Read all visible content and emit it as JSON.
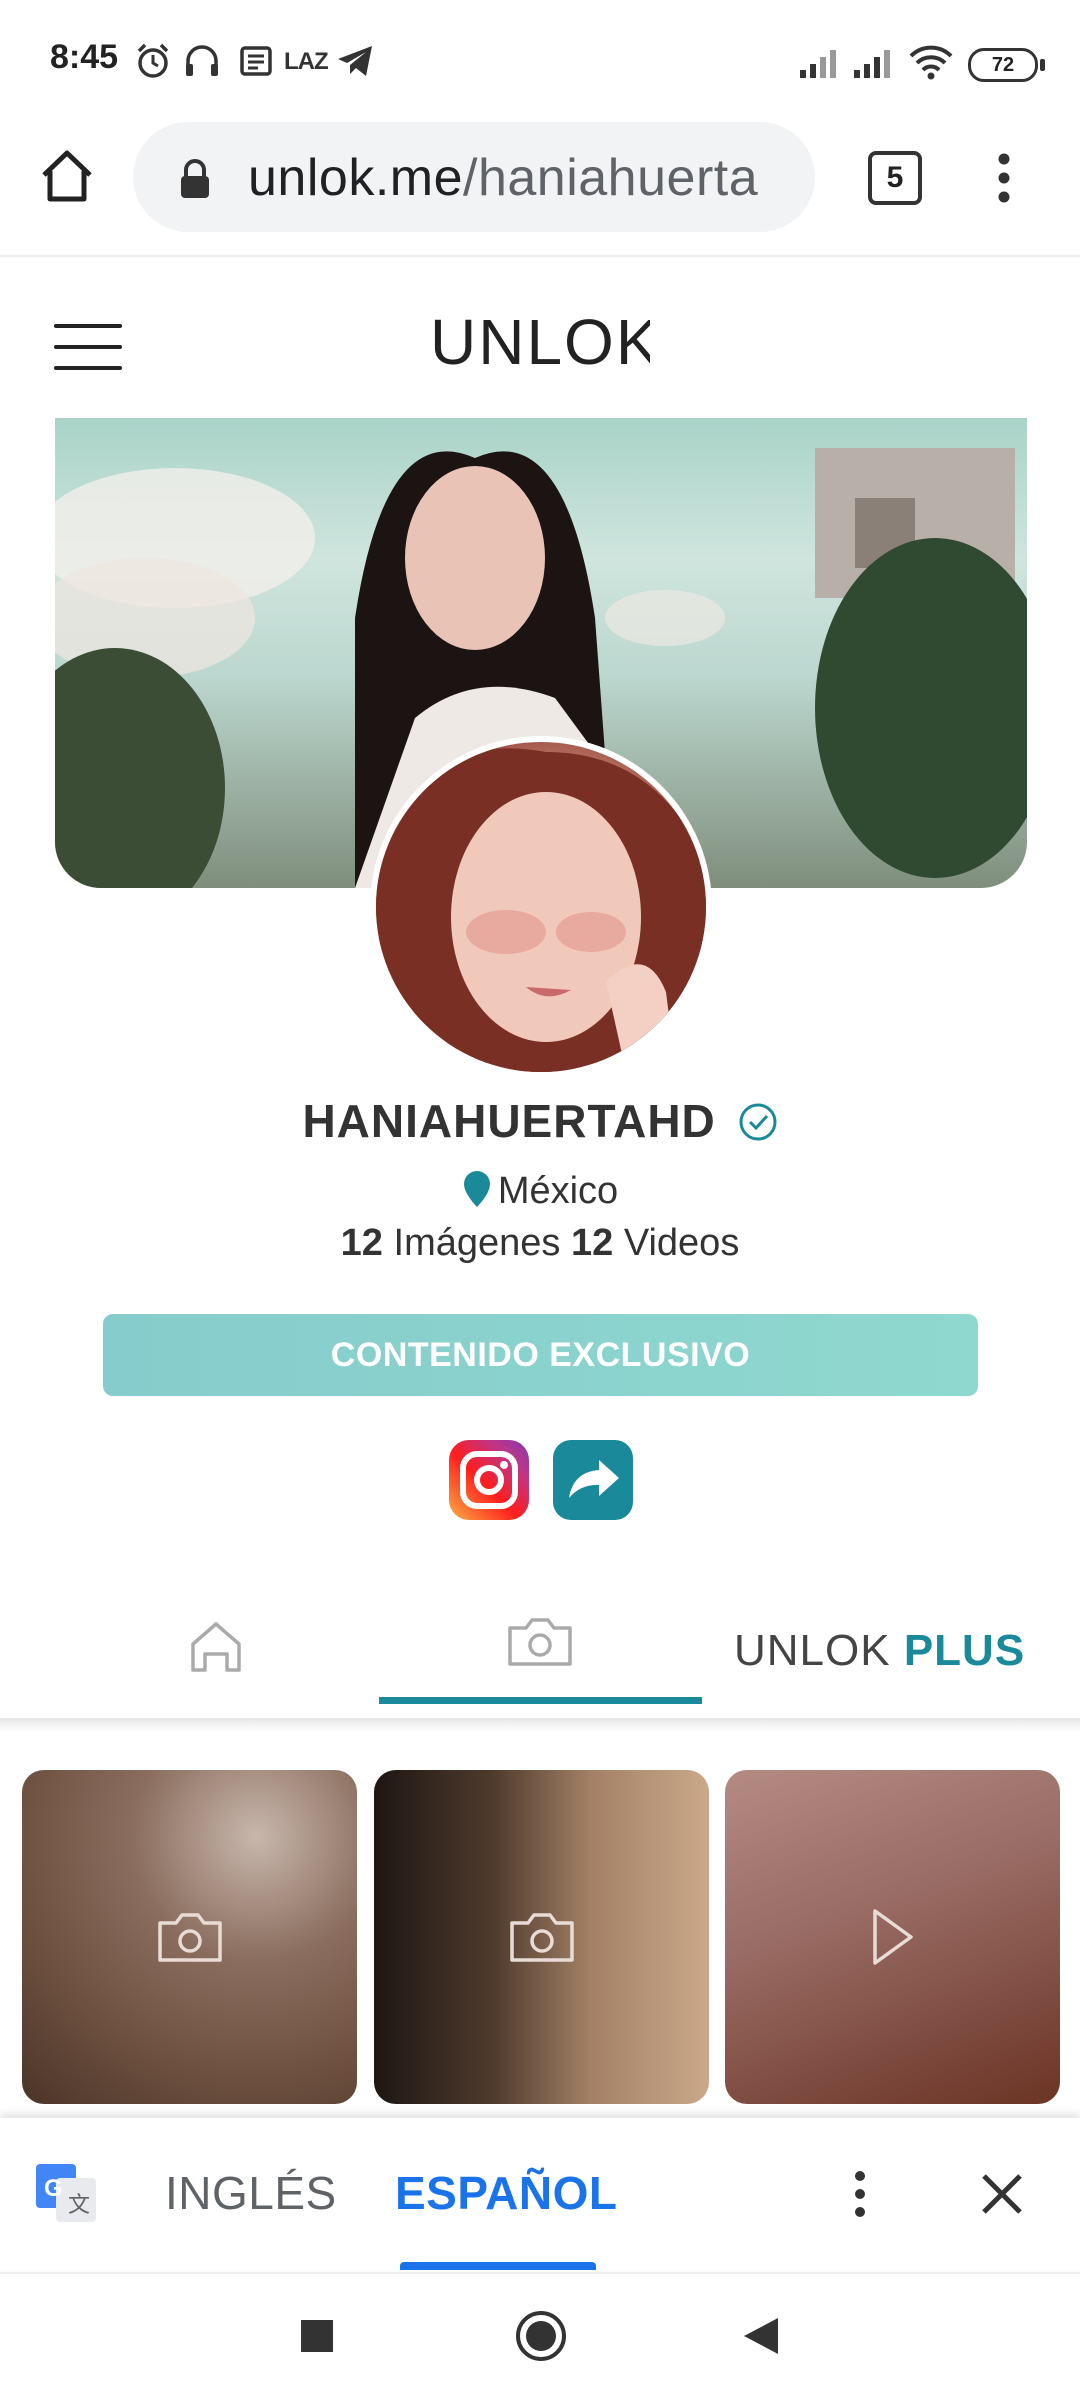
{
  "status_bar": {
    "time": "8:45",
    "notification_text": "LAZ",
    "battery": "72"
  },
  "browser": {
    "url_host": "unlok.me",
    "url_path": "/haniahuerta",
    "tabs_count": "5"
  },
  "site": {
    "logo_text": "UNLOK"
  },
  "profile": {
    "username": "HANIAHUERTAHD",
    "location": "México",
    "images_count": "12",
    "images_label": "Imágenes",
    "videos_count": "12",
    "videos_label": "Videos",
    "exclusive_button": "CONTENIDO EXCLUSIVO"
  },
  "tabs": {
    "plus_brand": "UNLOK",
    "plus_label": "PLUS",
    "active_tab": "photos"
  },
  "grid": [
    {
      "type": "photo-icon"
    },
    {
      "type": "photo-icon"
    },
    {
      "type": "play-icon"
    }
  ],
  "translate_bar": {
    "lang_source": "INGLÉS",
    "lang_target": "ESPAÑOL"
  },
  "colors": {
    "accent": "#1a8a9a",
    "button": "#8fd4ce",
    "translate_blue": "#1a73e8"
  }
}
